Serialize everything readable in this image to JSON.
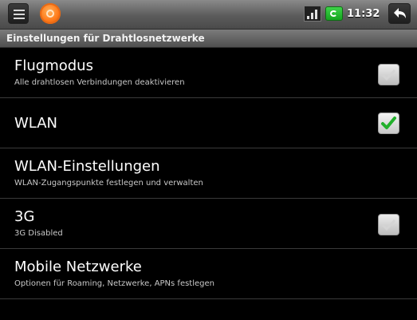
{
  "status_bar": {
    "menu_icon": "menu-icon",
    "app_icon": "orange-app-icon",
    "signal_icon": "signal-icon",
    "battery_icon": "battery-charging-icon",
    "time": "11:32",
    "back_icon": "back-icon"
  },
  "title_bar": {
    "title": "Einstellungen für Drahtlosnetzwerke"
  },
  "settings": [
    {
      "title": "Flugmodus",
      "summary": "Alle drahtlosen Verbindungen deaktivieren",
      "checkbox": "unchecked"
    },
    {
      "title": "WLAN",
      "summary": "",
      "checkbox": "checked"
    },
    {
      "title": "WLAN-Einstellungen",
      "summary": "WLAN-Zugangspunkte festlegen und verwalten",
      "checkbox": "none"
    },
    {
      "title": "3G",
      "summary": "3G Disabled",
      "checkbox": "unchecked"
    },
    {
      "title": "Mobile Netzwerke",
      "summary": "Optionen für Roaming, Netzwerke, APNs festlegen",
      "checkbox": "none"
    }
  ],
  "colors": {
    "background": "#000000",
    "check_green": "#22b02c",
    "check_gray": "#d0d0d0",
    "divider": "#3a3a3a"
  }
}
